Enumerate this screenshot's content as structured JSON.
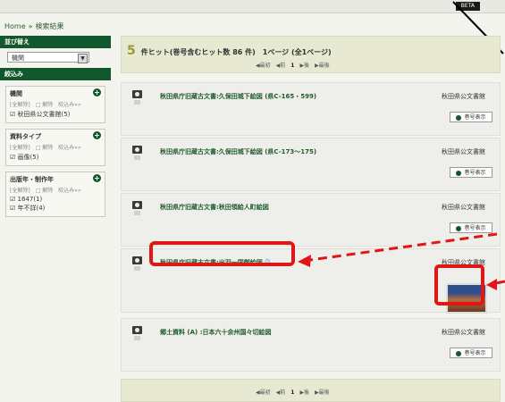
{
  "topbar": {
    "tab_label": "BETA"
  },
  "breadcrumb": {
    "home": "Home",
    "sep": "»",
    "current": "検索結果"
  },
  "sidebar": {
    "sort_header": "並び替え",
    "sort_value": "機関",
    "filter_header": "絞込み",
    "filters": [
      {
        "title": "機関",
        "all": "[全解除]",
        "clear": "□ 解除",
        "narrow": "絞込み»»",
        "items": [
          "☑ 秋田県公文書館(5)"
        ]
      },
      {
        "title": "資料タイプ",
        "all": "[全解除]",
        "clear": "□ 解除",
        "narrow": "絞込み»»",
        "items": [
          "☑ 画像(5)"
        ]
      },
      {
        "title": "出版年・制作年",
        "all": "[全解除]",
        "clear": "□ 解除",
        "narrow": "絞込み»»",
        "items": [
          "☑ 1647(1)",
          "☑ 年不詳(4)"
        ]
      }
    ]
  },
  "hits": {
    "count": "5",
    "text": "件ヒット(巻号含むヒット数 86 件)　1ページ (全1ページ)"
  },
  "pager": {
    "first": "◀最初",
    "prev": "◀前",
    "page": "1",
    "next": "▶後",
    "last": "▶最後"
  },
  "results": [
    {
      "title": "秋田県庁旧蔵古文書:久保田城下絵図 (県C-165・599)",
      "owner": "秋田県公文書館",
      "button": "巻号表示"
    },
    {
      "title": "秋田県庁旧蔵古文書:久保田城下絵図 (県C-173〜175)",
      "owner": "秋田県公文書館",
      "button": "巻号表示"
    },
    {
      "title": "秋田県庁旧蔵古文書:秋田領給人町絵図",
      "owner": "秋田県公文書館",
      "button": "巻号表示"
    },
    {
      "title": "秋田県庁旧蔵古文書:出羽一国御絵図",
      "owner": "秋田県公文書館",
      "button": ""
    },
    {
      "title": "郷土資料 (A) :日本六十余州国々切絵図",
      "owner": "秋田県公文書館",
      "button": "巻号表示"
    }
  ],
  "colors": {
    "brand_green": "#13572c",
    "highlight_red": "#e11616",
    "hits_bg": "#e7e9d3"
  }
}
